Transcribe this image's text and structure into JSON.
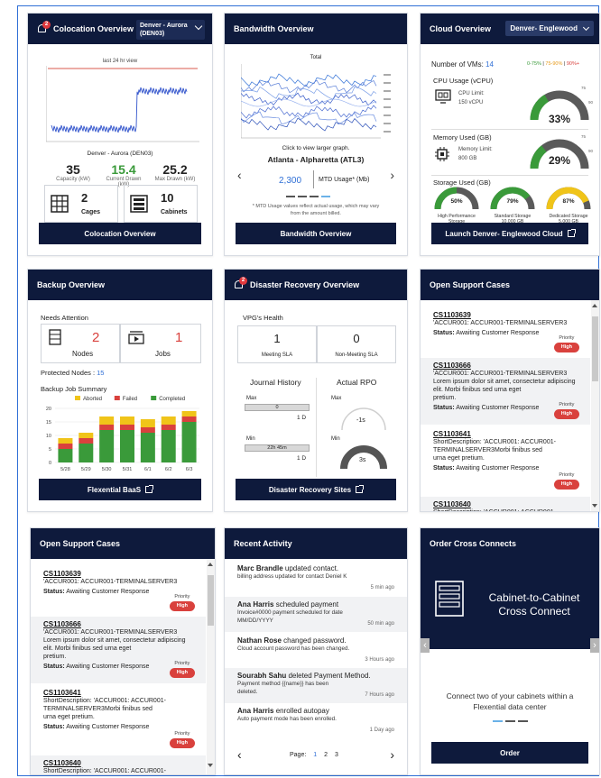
{
  "colocation": {
    "title": "Colocation Overview",
    "badge": "2",
    "location_select": "Denver - Aurora (DEN03)",
    "chart_label": "last 24 hr view",
    "site_name": "Denver - Aurora (DEN03)",
    "capacity": {
      "value": "35",
      "label": "Capacity (kW)"
    },
    "current": {
      "value": "15.4",
      "label": "Current Drawn (kW)"
    },
    "max": {
      "value": "25.2",
      "label": "Max Drawn (kW)"
    },
    "cages": {
      "value": "2",
      "label": "Cages"
    },
    "cabinets": {
      "value": "10",
      "label": "Cabinets"
    },
    "button": "Colocation Overview",
    "colors": {
      "current": "#3a9a3a",
      "line": "#3355cc",
      "redline": "#e07a70"
    }
  },
  "bandwidth": {
    "title": "Bandwidth Overview",
    "chart_title": "Total",
    "click_hint": "Click to view larger graph.",
    "site": "Atlanta - Alpharetta (ATL3)",
    "usage_value": "2,300",
    "usage_label": "MTD Usage* (Mb)",
    "footnote": "* MTD Usage values reflect actual usage, which may vary from the amount billed.",
    "button": "Bandwidth Overview"
  },
  "cloud": {
    "title": "Cloud Overview",
    "location_select": "Denver- Englewood",
    "vms_label": "Number of VMs:",
    "vms_value": "14",
    "legend": [
      "0-75%",
      "75-90%",
      "90%+"
    ],
    "cpu": {
      "title": "CPU Usage (vCPU)",
      "limit_label": "CPU Limit:",
      "limit_value": "150 vCPU",
      "percent": "33%",
      "fill": 0.33
    },
    "memory": {
      "title": "Memory Used (GB)",
      "limit_label": "Memory Limit:",
      "limit_value": "800 GB",
      "percent": "29%",
      "fill": 0.29
    },
    "storage": {
      "title": "Storage Used (GB)",
      "items": [
        {
          "percent": "50%",
          "name": "High Performance Storage",
          "size": "15,000 GB",
          "fill": 0.5,
          "color": "#3a9a3a"
        },
        {
          "percent": "79%",
          "name": "Standard Storage",
          "size": "10,000 GB",
          "fill": 0.79,
          "color": "#3a9a3a"
        },
        {
          "percent": "87%",
          "name": "Dedicated Storage",
          "size": "5,000 GB",
          "fill": 0.87,
          "color": "#f0c419"
        }
      ]
    },
    "gauge_ticks": {
      "t75": "75",
      "t90": "90"
    },
    "button": "Launch Denver- Englewood Cloud"
  },
  "backup": {
    "title": "Backup Overview",
    "needs_attention": "Needs Attention",
    "nodes": {
      "value": "2",
      "label": "Nodes"
    },
    "jobs": {
      "value": "1",
      "label": "Jobs"
    },
    "protected_label": "Protected Nodes :",
    "protected_value": "15",
    "summary_title": "Backup Job Summary",
    "button": "Flexential BaaS"
  },
  "chart_data": {
    "type": "bar",
    "categories": [
      "5/28",
      "5/29",
      "5/30",
      "5/31",
      "6/1",
      "6/2",
      "6/3"
    ],
    "series": [
      {
        "name": "Completed",
        "values": [
          5,
          7,
          12,
          12,
          11,
          12,
          15
        ],
        "color": "#3a9a3a"
      },
      {
        "name": "Failed",
        "values": [
          2,
          2,
          2,
          2,
          2,
          2,
          2
        ],
        "color": "#d9413d"
      },
      {
        "name": "Aborted",
        "values": [
          2,
          2,
          3,
          3,
          3,
          3,
          2
        ],
        "color": "#f0c419"
      }
    ],
    "ylim": [
      0,
      20
    ],
    "yticks": [
      "20",
      "15",
      "10",
      "5",
      "0"
    ],
    "legend_position": "top"
  },
  "dr": {
    "title": "Disaster Recovery Overview",
    "badge": "2",
    "vpg_health": "VPG's Health",
    "meeting": {
      "value": "1",
      "label": "Meeting SLA"
    },
    "non_meeting": {
      "value": "0",
      "label": "Non-Meeting SLA"
    },
    "journal_title": "Journal History",
    "rpo_title": "Actual RPO",
    "max_label": "Max",
    "min_label": "Min",
    "journal_max_bar": "0",
    "journal_max_value": "1 D",
    "journal_min_bar": "22h 45m",
    "journal_min_value": "1 D",
    "rpo_max": "-1s",
    "rpo_min": "3s",
    "button": "Disaster Recovery Sites"
  },
  "support": {
    "title": "Open Support Cases",
    "priority_label": "Priority",
    "high_label": "High",
    "status_label": "Status:",
    "cases": [
      {
        "id": "CS1103639",
        "desc": "'ACCUR001: ACCUR001-TERMINALSERVER3",
        "desc2": "",
        "desc3": "",
        "status": "Awaiting Customer Response"
      },
      {
        "id": "CS1103666",
        "desc": "'ACCUR001: ACCUR001-TERMINALSERVER3",
        "desc2": "Lorem ipsum dolor sit amet, consectetur adipiscing elit. Morbi finibus sed urna eget",
        "desc3": "pretium.",
        "status": "Awaiting Customer Response"
      },
      {
        "id": "CS1103641",
        "desc": "ShortDescription: 'ACCUR001: ACCUR001-",
        "desc2": "TERMINALSERVER3Morbi finibus sed",
        "desc3": "urna eget pretium.",
        "status": "Awaiting Customer Response"
      },
      {
        "id": "CS1103640",
        "desc": "ShortDescription: 'ACCUR001: ACCUR001-",
        "desc2": "",
        "desc3": "",
        "status": ""
      }
    ]
  },
  "activity": {
    "title": "Recent Activity",
    "items": [
      {
        "name": "Marc Brandle",
        "action": "updated contact.",
        "detail": "billing address updated for contact Deniel K",
        "time": "5 min ago"
      },
      {
        "name": "Ana Harris",
        "action": "scheduled payment",
        "detail": "Invoice#0000 payment scheduled for date MM/DD/YYYY",
        "time": "50 min ago"
      },
      {
        "name": "Nathan Rose",
        "action": "changed password.",
        "detail": "Cloud account password has been changed.",
        "time": "3 Hours ago"
      },
      {
        "name": "Sourabh Sahu",
        "action": "deleted Payment Method.",
        "detail": "Payment method {{name}} has been deleted.",
        "time": "7 Hours ago"
      },
      {
        "name": "Ana Harris",
        "action": "enrolled autopay",
        "detail": "Auto payment mode has been enrolled.",
        "time": "1 Day ago"
      }
    ],
    "page_label": "Page:",
    "pages": [
      "1",
      "2",
      "3"
    ]
  },
  "cross": {
    "title": "Order Cross Connects",
    "banner_line1": "Cabinet-to-Cabinet",
    "banner_line2": "Cross Connect",
    "caption": "Connect two of your cabinets within a Flexential data center",
    "button": "Order"
  }
}
